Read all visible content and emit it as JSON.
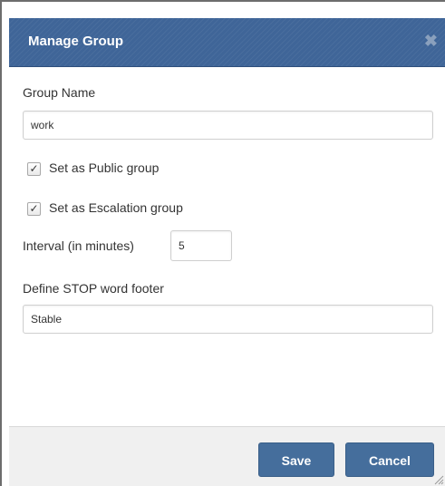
{
  "dialog": {
    "title": "Manage Group",
    "close_glyph": "✖"
  },
  "form": {
    "group_name_label": "Group Name",
    "group_name_value": "work",
    "public_checkbox_label": "Set as Public group",
    "public_checked": true,
    "escalation_checkbox_label": "Set as Escalation group",
    "escalation_checked": true,
    "check_glyph": "✓",
    "interval_label": "Interval (in minutes)",
    "interval_value": "5",
    "stop_footer_label": "Define STOP word footer",
    "stop_footer_value": "Stable"
  },
  "footer": {
    "save_label": "Save",
    "cancel_label": "Cancel"
  },
  "colors": {
    "header_bg": "#3f6598",
    "button_bg": "#456e9c",
    "footer_bg": "#f0f0f0"
  },
  "icons": {
    "close": "close-icon",
    "check": "check-icon",
    "resize": "resize-grip-icon"
  }
}
